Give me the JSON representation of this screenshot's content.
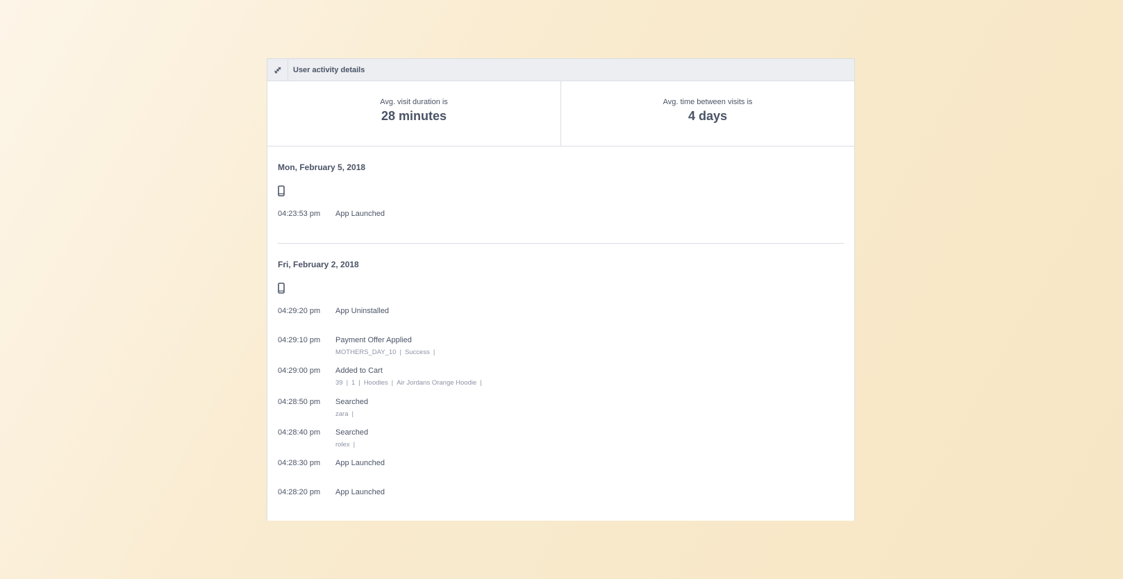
{
  "panel": {
    "title": "User activity details",
    "header_icon": "pencil-icon"
  },
  "stats": {
    "visit_duration_label": "Avg. visit duration is",
    "visit_duration_value": "28 minutes",
    "time_between_label": "Avg. time between visits is",
    "time_between_value": "4 days"
  },
  "days": [
    {
      "date": "Mon, February 5, 2018",
      "device_icon": "mobile-phone-icon",
      "events": [
        {
          "time": "04:23:53 pm",
          "name": "App Launched",
          "props": []
        }
      ]
    },
    {
      "date": "Fri, February 2, 2018",
      "device_icon": "mobile-phone-icon",
      "events": [
        {
          "time": "04:29:20 pm",
          "name": "App Uninstalled",
          "props": []
        },
        {
          "time": "04:29:10 pm",
          "name": "Payment Offer Applied",
          "props": [
            "MOTHERS_DAY_10",
            "Success"
          ]
        },
        {
          "time": "04:29:00 pm",
          "name": "Added to Cart",
          "props": [
            "39",
            "1",
            "Hoodies",
            "Air Jordans Orange Hoodie"
          ]
        },
        {
          "time": "04:28:50 pm",
          "name": "Searched",
          "props": [
            "zara"
          ]
        },
        {
          "time": "04:28:40 pm",
          "name": "Searched",
          "props": [
            "rolex"
          ]
        },
        {
          "time": "04:28:30 pm",
          "name": "App Launched",
          "props": []
        },
        {
          "time": "04:28:20 pm",
          "name": "App Launched",
          "props": []
        }
      ]
    }
  ],
  "colors": {
    "text": "#4a5366",
    "muted": "#8b93a5",
    "border": "#d9dde3",
    "header_bg": "#eceef1"
  }
}
